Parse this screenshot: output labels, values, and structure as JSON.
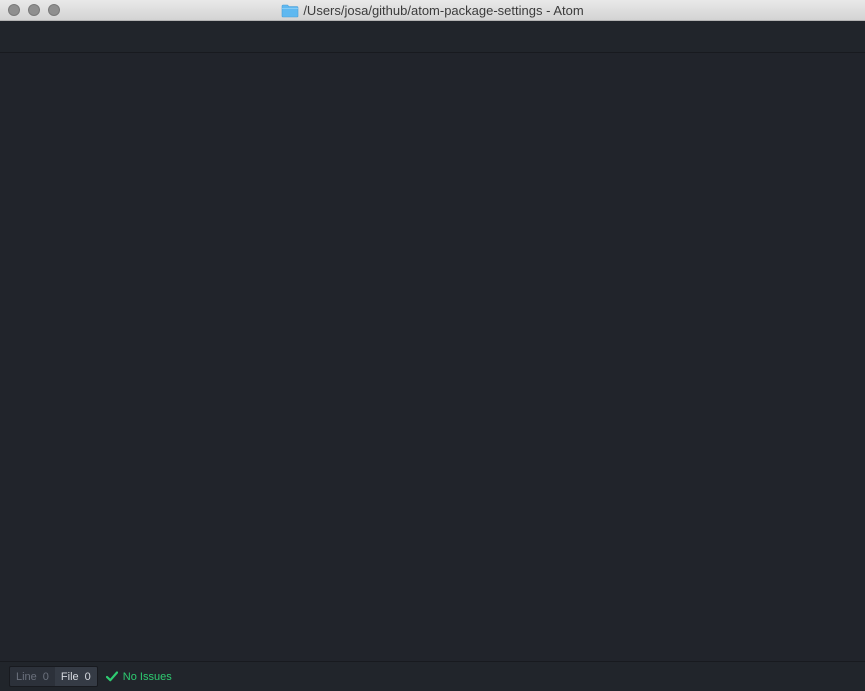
{
  "window": {
    "title": "/Users/josa/github/atom-package-settings - Atom"
  },
  "statusbar": {
    "line_tab": {
      "label": "Line",
      "count": "0"
    },
    "file_tab": {
      "label": "File",
      "count": "0"
    },
    "issues_text": "No Issues"
  },
  "icons": {
    "folder": "folder-icon",
    "check": "checkmark-icon"
  },
  "colors": {
    "editor_bg": "#21242b",
    "success": "#2ecc71",
    "folder": "#5fb8f0"
  }
}
